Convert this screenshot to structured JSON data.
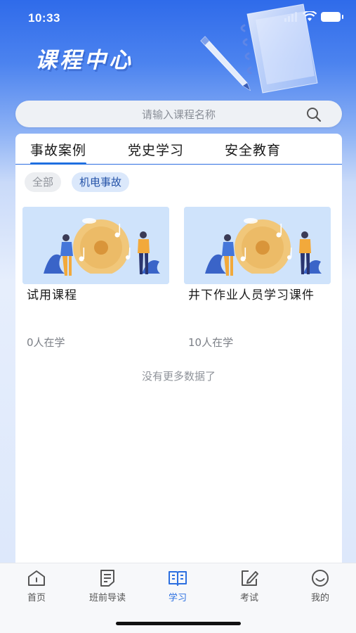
{
  "status_bar": {
    "time": "10:33"
  },
  "header": {
    "title": "课程中心"
  },
  "search": {
    "placeholder": "请输入课程名称"
  },
  "tabs": [
    {
      "label": "事故案例",
      "active": true
    },
    {
      "label": "党史学习",
      "active": false
    },
    {
      "label": "安全教育",
      "active": false
    }
  ],
  "filters": [
    {
      "label": "全部",
      "selected": false
    },
    {
      "label": "机电事故",
      "selected": true
    }
  ],
  "courses": [
    {
      "title": "试用课程",
      "learners": "0人在学"
    },
    {
      "title": "井下作业人员学习课件",
      "learners": "10人在学"
    }
  ],
  "list_end_text": "没有更多数据了",
  "bottom_nav": [
    {
      "label": "首页",
      "icon": "home-icon",
      "active": false
    },
    {
      "label": "班前导读",
      "icon": "document-icon",
      "active": false
    },
    {
      "label": "学习",
      "icon": "book-icon",
      "active": true
    },
    {
      "label": "考试",
      "icon": "edit-icon",
      "active": false
    },
    {
      "label": "我的",
      "icon": "smile-icon",
      "active": false
    }
  ],
  "colors": {
    "accent": "#2c6fe0",
    "header_bg": "#2f6bea",
    "chip_selected_bg": "#dbe8fb"
  }
}
